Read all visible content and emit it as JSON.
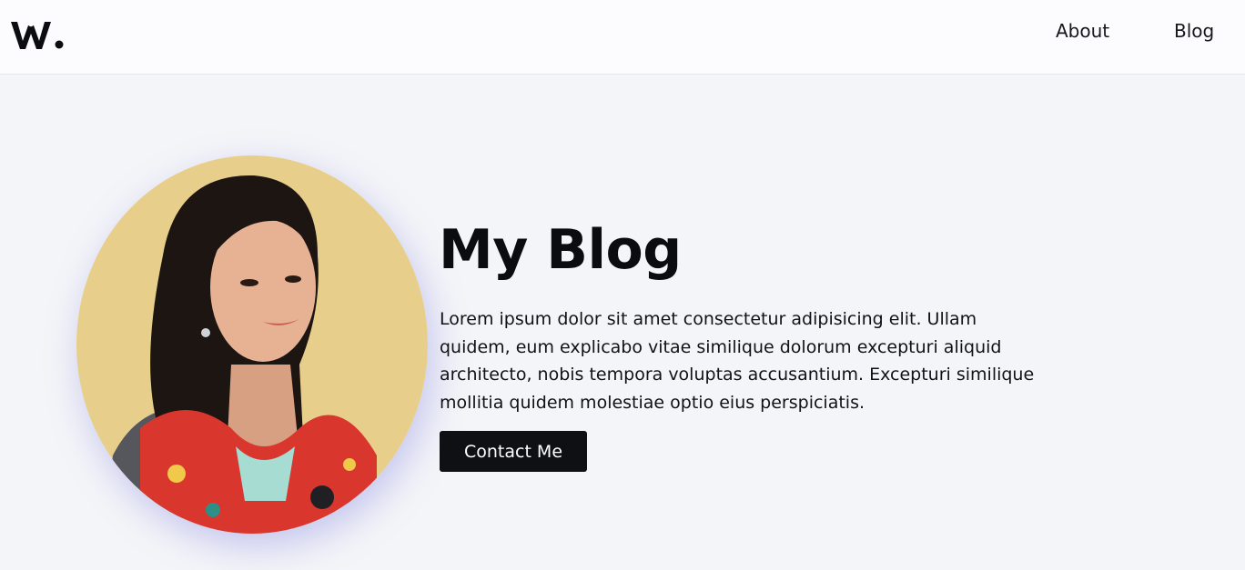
{
  "header": {
    "logo_icon": "w-dot-logo-icon",
    "nav": [
      {
        "label": "About"
      },
      {
        "label": "Blog"
      }
    ]
  },
  "hero": {
    "title": "My Blog",
    "intro": "Lorem ipsum dolor sit amet consectetur adipisicing elit. Ullam quidem, eum explicabo vitae similique dolorum excepturi aliquid architecto, nobis tempora voluptas accusantium. Excepturi similique mollitia quidem molestiae optio eius perspiciatis.",
    "cta_label": "Contact Me",
    "portrait_alt": "portrait-photo"
  },
  "colors": {
    "background": "#f4f5f8",
    "header_background": "#fcfcfe",
    "text": "#0c0d10",
    "button_background": "#0f1014",
    "button_text": "#ffffff",
    "portrait_backdrop": "#e7cf8b",
    "shadow_accent": "#6e6edc"
  }
}
